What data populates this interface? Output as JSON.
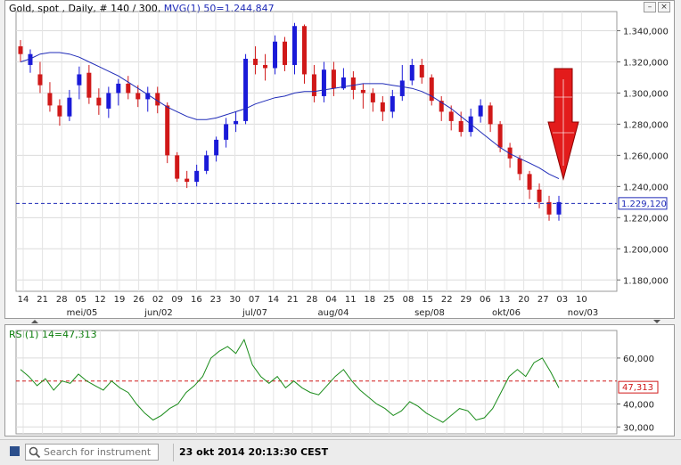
{
  "chart_header": {
    "instrument": "Gold, spot , Daily, # 140 / 300,",
    "ma_label": "MVG(1) 50=1.244,847"
  },
  "rsi_header": {
    "label": "RSI(1) 14=47,313"
  },
  "price_axis": {
    "labels": [
      "1.340,000",
      "1.320,000",
      "1.300,000",
      "1.280,000",
      "1.260,000",
      "1.240,000",
      "1.220,000",
      "1.200,000",
      "1.180,000"
    ],
    "current_price": "1.229,120"
  },
  "rsi_axis": {
    "labels": [
      "60,000",
      "40,000",
      "30,000"
    ],
    "current_value": "47,313"
  },
  "x_axis": {
    "days": [
      "14",
      "21",
      "28",
      "05",
      "12",
      "19",
      "26",
      "02",
      "09",
      "16",
      "23",
      "30",
      "07",
      "14",
      "21",
      "28",
      "04",
      "11",
      "18",
      "25",
      "08",
      "15",
      "22",
      "29",
      "06",
      "13",
      "20",
      "27",
      "03",
      "10"
    ],
    "months": [
      "mei/05",
      "jun/02",
      "jul/07",
      "aug/04",
      "sep/08",
      "okt/06",
      "nov/03"
    ]
  },
  "status": {
    "search_placeholder": "Search for instrument",
    "timestamp": "23 okt 2014 20:13:30 CEST"
  },
  "colors": {
    "up": "#1a1ad8",
    "down": "#d01818",
    "ma": "#1f2bb8",
    "rsi": "#1a8c1a",
    "reference": "#d01818",
    "current_price_line": "#1f2bb8",
    "arrow": "#e31b1b"
  },
  "icons": {
    "search": "search-icon",
    "arrow": "red-down-arrow-icon"
  },
  "chart_data": [
    {
      "type": "candlestick",
      "title": "Gold, spot , Daily",
      "ylim": [
        1180,
        1350
      ],
      "ma_series": [
        1320,
        1322,
        1325,
        1326,
        1326,
        1325,
        1323,
        1320,
        1317,
        1314,
        1311,
        1307,
        1303,
        1299,
        1295,
        1291,
        1288,
        1285,
        1283,
        1283,
        1284,
        1286,
        1288,
        1290,
        1293,
        1295,
        1297,
        1298,
        1300,
        1301,
        1301,
        1302,
        1303,
        1304,
        1305,
        1306,
        1306,
        1306,
        1305,
        1304,
        1303,
        1301,
        1298,
        1294,
        1290,
        1285,
        1280,
        1275,
        1270,
        1265,
        1261,
        1258,
        1255,
        1252,
        1248,
        1245
      ],
      "candles": [
        [
          1330,
          1325,
          1334,
          1320
        ],
        [
          1318,
          1325,
          1328,
          1313
        ],
        [
          1312,
          1305,
          1320,
          1300
        ],
        [
          1300,
          1292,
          1307,
          1288
        ],
        [
          1292,
          1285,
          1296,
          1279
        ],
        [
          1285,
          1297,
          1302,
          1282
        ],
        [
          1305,
          1312,
          1317,
          1296
        ],
        [
          1313,
          1297,
          1318,
          1293
        ],
        [
          1297,
          1292,
          1303,
          1286
        ],
        [
          1290,
          1300,
          1304,
          1284
        ],
        [
          1300,
          1306,
          1309,
          1292
        ],
        [
          1306,
          1300,
          1311,
          1296
        ],
        [
          1300,
          1296,
          1305,
          1291
        ],
        [
          1296,
          1300,
          1304,
          1288
        ],
        [
          1300,
          1292,
          1304,
          1287
        ],
        [
          1292,
          1260,
          1294,
          1255
        ],
        [
          1260,
          1245,
          1262,
          1243
        ],
        [
          1245,
          1243,
          1250,
          1239
        ],
        [
          1243,
          1250,
          1254,
          1240
        ],
        [
          1250,
          1260,
          1263,
          1248
        ],
        [
          1260,
          1270,
          1272,
          1256
        ],
        [
          1270,
          1280,
          1284,
          1265
        ],
        [
          1280,
          1282,
          1288,
          1275
        ],
        [
          1282,
          1322,
          1325,
          1280
        ],
        [
          1322,
          1318,
          1330,
          1312
        ],
        [
          1318,
          1316,
          1325,
          1308
        ],
        [
          1316,
          1333,
          1337,
          1312
        ],
        [
          1333,
          1318,
          1336,
          1314
        ],
        [
          1318,
          1343,
          1345,
          1312
        ],
        [
          1343,
          1312,
          1344,
          1306
        ],
        [
          1312,
          1298,
          1318,
          1294
        ],
        [
          1298,
          1315,
          1320,
          1294
        ],
        [
          1315,
          1303,
          1320,
          1298
        ],
        [
          1303,
          1310,
          1316,
          1302
        ],
        [
          1310,
          1302,
          1314,
          1296
        ],
        [
          1302,
          1300,
          1306,
          1290
        ],
        [
          1300,
          1294,
          1303,
          1288
        ],
        [
          1294,
          1288,
          1298,
          1282
        ],
        [
          1288,
          1298,
          1302,
          1284
        ],
        [
          1298,
          1308,
          1318,
          1295
        ],
        [
          1308,
          1318,
          1322,
          1305
        ],
        [
          1318,
          1310,
          1322,
          1306
        ],
        [
          1310,
          1295,
          1312,
          1292
        ],
        [
          1295,
          1288,
          1298,
          1282
        ],
        [
          1288,
          1282,
          1292,
          1276
        ],
        [
          1282,
          1275,
          1288,
          1272
        ],
        [
          1275,
          1285,
          1290,
          1272
        ],
        [
          1285,
          1292,
          1296,
          1281
        ],
        [
          1292,
          1280,
          1294,
          1275
        ],
        [
          1280,
          1265,
          1282,
          1262
        ],
        [
          1265,
          1258,
          1268,
          1252
        ],
        [
          1258,
          1248,
          1260,
          1244
        ],
        [
          1248,
          1238,
          1250,
          1232
        ],
        [
          1238,
          1230,
          1242,
          1226
        ],
        [
          1230,
          1222,
          1234,
          1218
        ],
        [
          1222,
          1230,
          1234,
          1218
        ]
      ],
      "reference_line": 1229.12
    },
    {
      "type": "line",
      "title": "RSI(1) 14",
      "ylim": [
        30,
        70
      ],
      "reference_line": 50,
      "values": [
        55,
        52,
        48,
        51,
        46,
        50,
        49,
        53,
        50,
        48,
        46,
        50,
        47,
        45,
        40,
        36,
        33,
        35,
        38,
        40,
        45,
        48,
        52,
        60,
        63,
        65,
        62,
        68,
        57,
        52,
        49,
        52,
        47,
        50,
        47,
        45,
        44,
        48,
        52,
        55,
        50,
        46,
        43,
        40,
        38,
        35,
        37,
        41,
        39,
        36,
        34,
        32,
        35,
        38,
        37,
        33,
        34,
        38,
        45,
        52,
        55,
        52,
        58,
        60,
        54,
        47
      ]
    }
  ]
}
